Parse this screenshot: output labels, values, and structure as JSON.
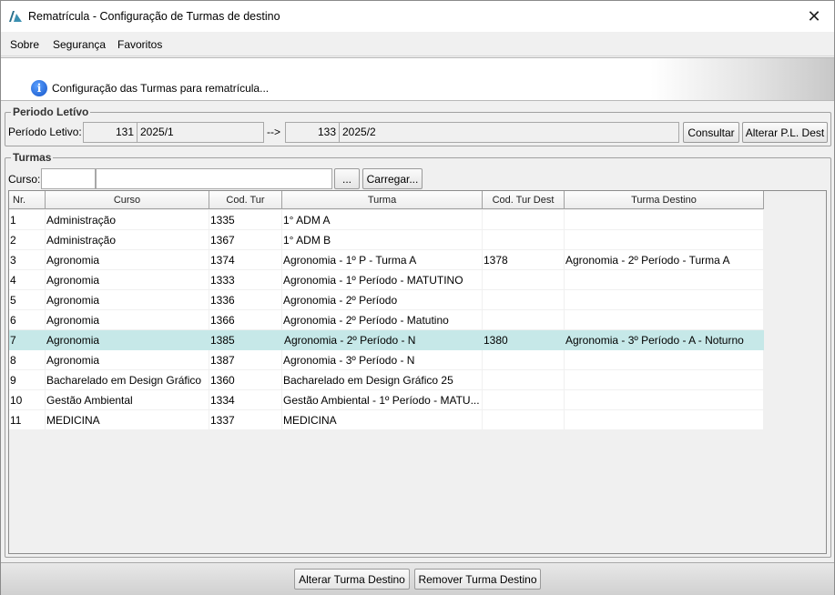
{
  "window": {
    "title": "Rematrícula - Configuração de Turmas de destino",
    "close_glyph": "✕"
  },
  "menu": [
    {
      "label": "Sobre"
    },
    {
      "label": "Segurança"
    },
    {
      "label": "Favoritos"
    }
  ],
  "header": {
    "icon": "info-icon",
    "icon_glyph": "i",
    "text": "Configuração das Turmas para rematrícula..."
  },
  "periodo": {
    "group_label": "Periodo Letívo",
    "label": "Período Letivo:",
    "from_code": "131",
    "from_name": "2025/1",
    "arrow": "-->",
    "to_code": "133",
    "to_name": "2025/2",
    "consultar_label": "Consultar",
    "alterar_label": "Alterar P.L. Dest"
  },
  "turmas": {
    "group_label": "Turmas",
    "curso_label": "Curso:",
    "curso_code": "",
    "curso_name": "",
    "browse_label": "...",
    "carregar_label": "Carregar...",
    "columns": [
      "Nr.",
      "Curso",
      "Cod. Tur",
      "Turma",
      "Cod. Tur Dest",
      "Turma Destino"
    ],
    "rows": [
      {
        "nr": "1",
        "curso": "Administração",
        "cod": "1335",
        "turma": "1° ADM A",
        "cod_dest": "",
        "turma_dest": ""
      },
      {
        "nr": "2",
        "curso": "Administração",
        "cod": "1367",
        "turma": "1° ADM B",
        "cod_dest": "",
        "turma_dest": ""
      },
      {
        "nr": "3",
        "curso": "Agronomia",
        "cod": "1374",
        "turma": "Agronomia - 1º P - Turma A",
        "cod_dest": "1378",
        "turma_dest": "Agronomia - 2º Período - Turma A"
      },
      {
        "nr": "4",
        "curso": "Agronomia",
        "cod": "1333",
        "turma": "Agronomia - 1º Período - MATUTINO",
        "cod_dest": "",
        "turma_dest": ""
      },
      {
        "nr": "5",
        "curso": "Agronomia",
        "cod": "1336",
        "turma": "Agronomia - 2º Período",
        "cod_dest": "",
        "turma_dest": ""
      },
      {
        "nr": "6",
        "curso": "Agronomia",
        "cod": "1366",
        "turma": "Agronomia - 2º Período - Matutino",
        "cod_dest": "",
        "turma_dest": ""
      },
      {
        "nr": "7",
        "curso": "Agronomia",
        "cod": "1385",
        "turma": "Agronomia - 2º Período - N",
        "cod_dest": "1380",
        "turma_dest": "Agronomia - 3º Período - A - Noturno",
        "selected": true
      },
      {
        "nr": "8",
        "curso": "Agronomia",
        "cod": "1387",
        "turma": "Agronomia - 3º Período - N",
        "cod_dest": "",
        "turma_dest": ""
      },
      {
        "nr": "9",
        "curso": "Bacharelado em Design Gráfico",
        "cod": "1360",
        "turma": "Bacharelado em Design Gráfico 25",
        "cod_dest": "",
        "turma_dest": ""
      },
      {
        "nr": "10",
        "curso": "Gestão Ambiental",
        "cod": "1334",
        "turma": "Gestão Ambiental - 1º Período - MATU...",
        "cod_dest": "",
        "turma_dest": ""
      },
      {
        "nr": "11",
        "curso": "MEDICINA",
        "cod": "1337",
        "turma": "MEDICINA",
        "cod_dest": "",
        "turma_dest": ""
      }
    ]
  },
  "footer": {
    "alterar_label": "Alterar Turma Destino",
    "remover_label": "Remover Turma Destino"
  },
  "colors": {
    "selected_row": "#c6e8e8",
    "focus_border": "#3c6ea8"
  }
}
